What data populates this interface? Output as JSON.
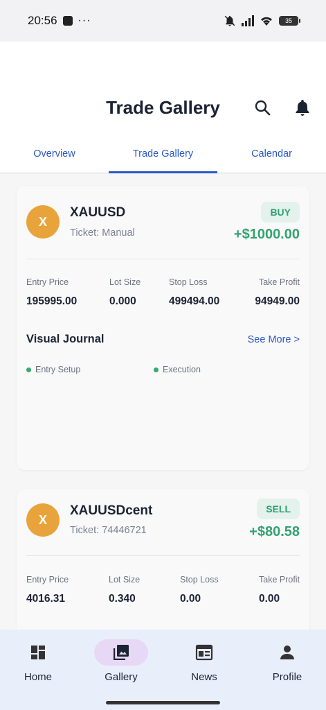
{
  "status_bar": {
    "time": "20:56",
    "dots": "···",
    "battery": "35"
  },
  "header": {
    "title": "Trade Gallery"
  },
  "tabs": [
    {
      "label": "Overview"
    },
    {
      "label": "Trade Gallery"
    },
    {
      "label": "Calendar"
    }
  ],
  "trades": [
    {
      "avatar": "X",
      "symbol": "XAUUSD",
      "ticket": "Ticket: Manual",
      "side": "BUY",
      "pnl": "+$1000.00",
      "stats": [
        {
          "label": "Entry Price",
          "value": "195995.00"
        },
        {
          "label": "Lot Size",
          "value": "0.000"
        },
        {
          "label": "Stop Loss",
          "value": "499494.00"
        },
        {
          "label": "Take Profit",
          "value": "94949.00"
        }
      ],
      "journal": {
        "title": "Visual Journal",
        "see_more": "See More >",
        "legend": [
          "Entry Setup",
          "Execution"
        ]
      }
    },
    {
      "avatar": "X",
      "symbol": "XAUUSDcent",
      "ticket": "Ticket: 74446721",
      "side": "SELL",
      "pnl": "+$80.58",
      "stats": [
        {
          "label": "Entry Price",
          "value": "4016.31"
        },
        {
          "label": "Lot Size",
          "value": "0.340"
        },
        {
          "label": "Stop Loss",
          "value": "0.00"
        },
        {
          "label": "Take Profit",
          "value": "0.00"
        }
      ]
    }
  ],
  "nav": [
    {
      "label": "Home",
      "icon": "dashboard-icon"
    },
    {
      "label": "Gallery",
      "icon": "photo-library-icon"
    },
    {
      "label": "News",
      "icon": "newspaper-icon"
    },
    {
      "label": "Profile",
      "icon": "person-icon"
    }
  ],
  "colors": {
    "accent": "#2a58c7",
    "profit": "#33a36f",
    "avatar": "#e8a43a",
    "nav_bg": "#e9eefb",
    "nav_active": "#e7d9f5"
  }
}
